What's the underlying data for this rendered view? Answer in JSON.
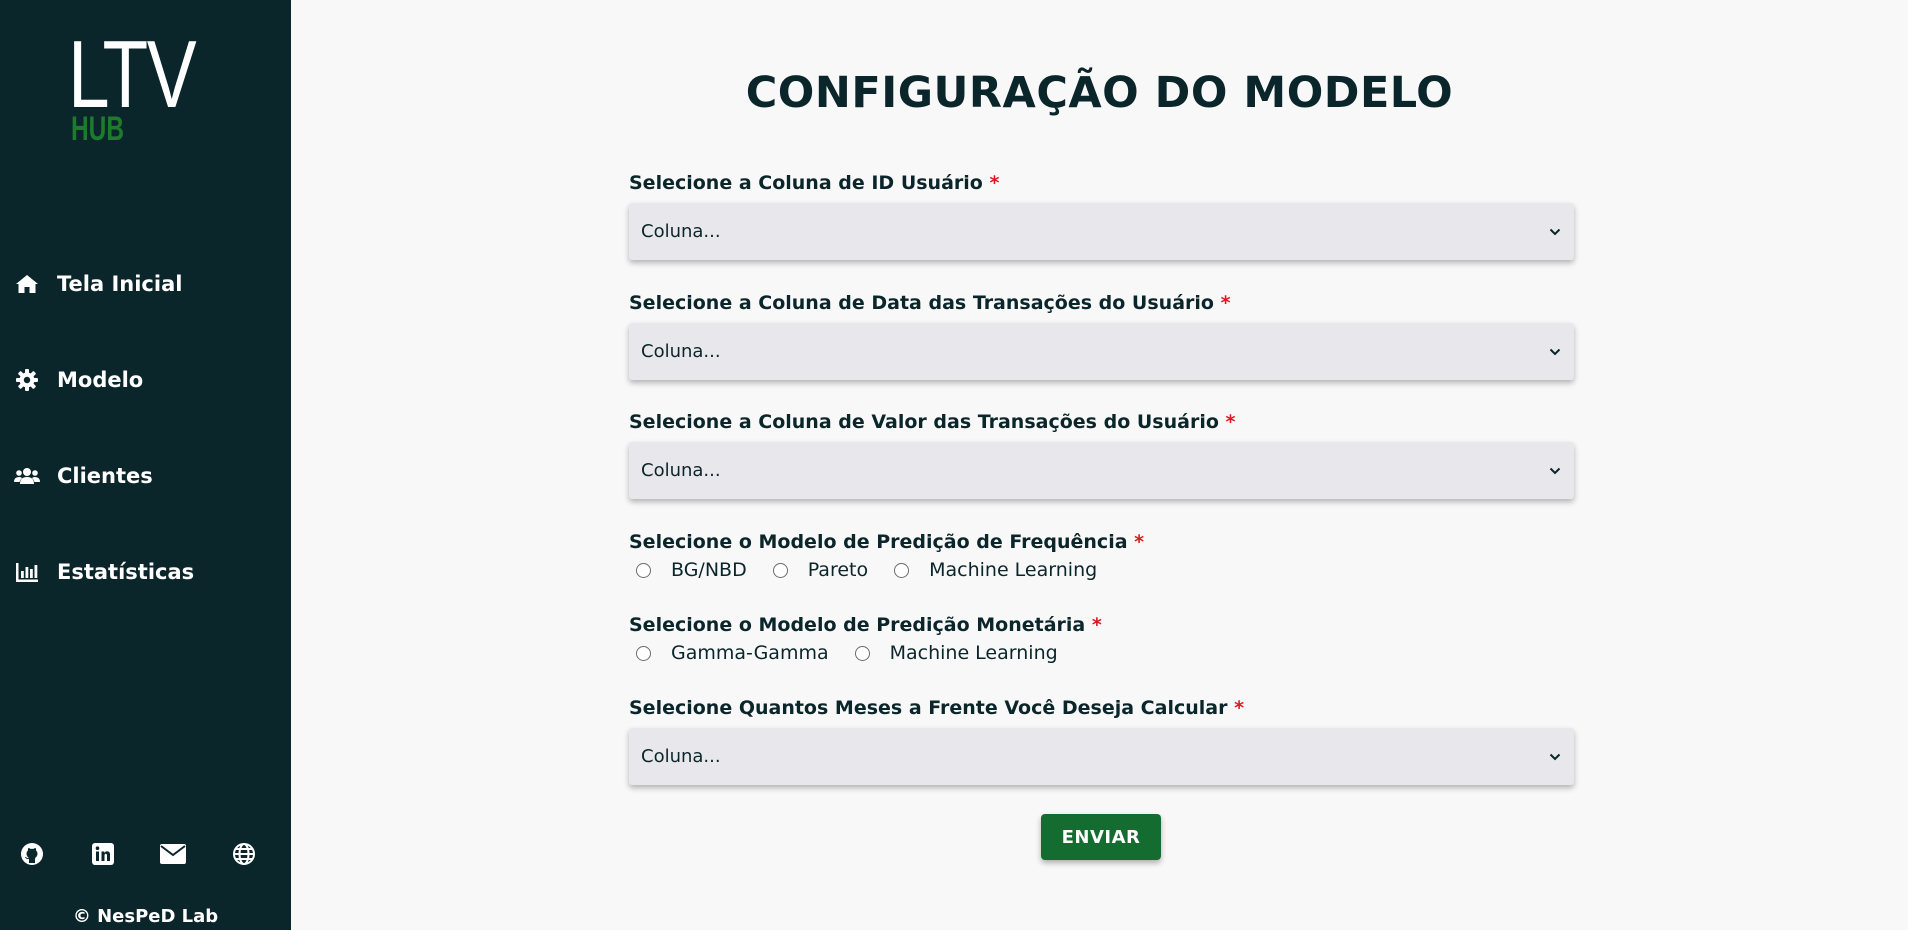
{
  "sidebar": {
    "logo": {
      "main": "LTV",
      "sub": "HUB"
    },
    "items": [
      {
        "label": "Tela Inicial",
        "icon": "home-icon"
      },
      {
        "label": "Modelo",
        "icon": "gear-icon"
      },
      {
        "label": "Clientes",
        "icon": "users-icon"
      },
      {
        "label": "Estatísticas",
        "icon": "bar-chart-icon"
      }
    ],
    "social": [
      "github-icon",
      "linkedin-icon",
      "envelope-icon",
      "globe-icon"
    ],
    "copyright": "© NesPeD Lab"
  },
  "main": {
    "title": "CONFIGURAÇÃO DO MODELO",
    "required_mark": "*",
    "fields": {
      "user_id": {
        "label": "Selecione a Coluna de ID Usuário",
        "value": "Coluna..."
      },
      "date": {
        "label": "Selecione a Coluna de Data das Transações do Usuário",
        "value": "Coluna..."
      },
      "amount": {
        "label": "Selecione a Coluna de Valor das Transações do Usuário",
        "value": "Coluna..."
      },
      "freq_model": {
        "label": "Selecione o Modelo de Predição de Frequência",
        "options": [
          "BG/NBD",
          "Pareto",
          "Machine Learning"
        ]
      },
      "monetary_model": {
        "label": "Selecione o Modelo de Predição Monetária",
        "options": [
          "Gamma-Gamma",
          "Machine Learning"
        ]
      },
      "months": {
        "label": "Selecione Quantos Meses a Frente Você Deseja Calcular",
        "value": "Coluna..."
      }
    },
    "submit_label": "ENVIAR"
  },
  "colors": {
    "sidebar_bg": "#0a262b",
    "accent_green": "#146c31",
    "logo_hub": "#1d7a2e",
    "required": "#e0171e",
    "background": "#f8f8f8"
  }
}
